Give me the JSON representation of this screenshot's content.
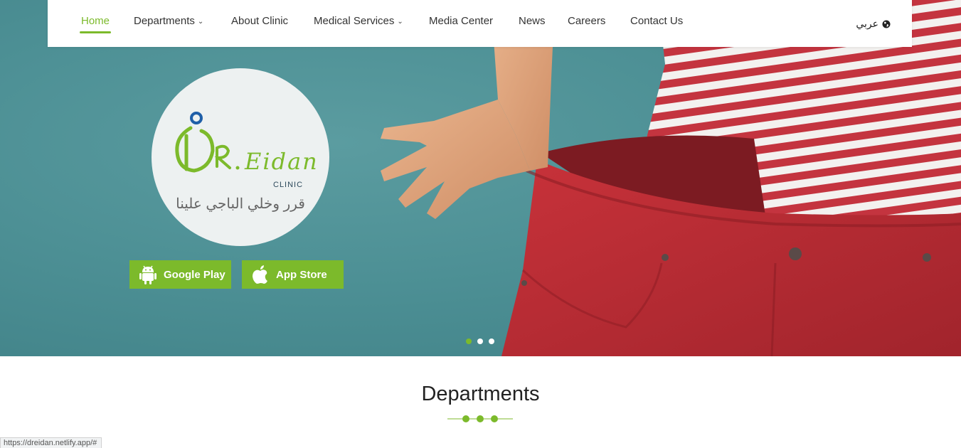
{
  "nav": {
    "items": [
      {
        "label": "Home",
        "active": true,
        "dropdown": false
      },
      {
        "label": "Departments",
        "active": false,
        "dropdown": true
      },
      {
        "label": "About Clinic",
        "active": false,
        "dropdown": false
      },
      {
        "label": "Medical Services",
        "active": false,
        "dropdown": true
      },
      {
        "label": "Media Center",
        "active": false,
        "dropdown": false
      },
      {
        "label": "News",
        "active": false,
        "dropdown": false
      },
      {
        "label": "Careers",
        "active": false,
        "dropdown": false
      },
      {
        "label": "Contact Us",
        "active": false,
        "dropdown": false
      }
    ],
    "language_label": "عربي",
    "caret_glyph": "⌄"
  },
  "hero": {
    "logo": {
      "brand_text": "DR.Eidan",
      "clinic_label": "CLINIC",
      "tagline": "قرر وخلي الباجي علينا"
    },
    "buttons": {
      "google_play": "Google Play",
      "app_store": "App Store"
    },
    "slider": {
      "count": 3,
      "active_index": 0
    }
  },
  "section": {
    "title": "Departments"
  },
  "status_bar": {
    "url": "https://dreidan.netlify.app/#"
  },
  "colors": {
    "accent": "#7cba2b",
    "hero_bg": "#4d9095",
    "logo_blue": "#1f5fa8"
  },
  "icons": {
    "language": "globe-icon",
    "google_play": "android-icon",
    "app_store": "apple-icon",
    "dropdown": "chevron-down-icon"
  }
}
